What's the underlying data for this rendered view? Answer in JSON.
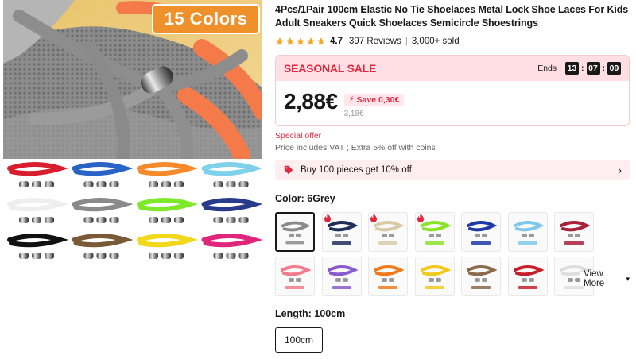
{
  "hero": {
    "badge_text": "15 Colors",
    "lace_colors": [
      "#d81e2c",
      "#2a63c6",
      "#f58a2a",
      "#7fd0ea",
      "#f5f5f5",
      "#8a8a8a",
      "#7ee82a",
      "#283a8a",
      "#111111",
      "#7a5a36",
      "#f2d81a",
      "#e0267a"
    ]
  },
  "product": {
    "title": "4Pcs/1Pair 100cm Elastic No Tie Shoelaces Metal Lock Shoe Laces For Kids Adult Sneakers Quick Shoelaces Semicircle Shoestrings",
    "rating": "4.7",
    "reviews": "397 Reviews",
    "separator": "|",
    "sold": "3,000+ sold"
  },
  "sale": {
    "label": "SEASONAL SALE",
    "ends_label": "Ends :",
    "hours": "13",
    "minutes": "07",
    "seconds": "09",
    "price": "2,88€",
    "save_text": "Save 0,30€",
    "old_price": "3,18€"
  },
  "special_offer": "Special offer",
  "vat_note": "Price includes VAT ; Extra 5% off with coins",
  "bulk": {
    "text": "Buy 100 pieces get 10% off"
  },
  "color": {
    "label": "Color: 6Grey",
    "swatches": [
      {
        "color": "#8a8a8a",
        "selected": true,
        "hot": false
      },
      {
        "color": "#1f2f5a",
        "selected": false,
        "hot": true
      },
      {
        "color": "#d9c9a8",
        "selected": false,
        "hot": true
      },
      {
        "color": "#8be22a",
        "selected": false,
        "hot": true
      },
      {
        "color": "#1f3aa8",
        "selected": false,
        "hot": false
      },
      {
        "color": "#7fc8ea",
        "selected": false,
        "hot": false
      },
      {
        "color": "#a8203a",
        "selected": false,
        "hot": false
      },
      {
        "color": "#f27a8a",
        "selected": false,
        "hot": false
      },
      {
        "color": "#8a5ad0",
        "selected": false,
        "hot": false
      },
      {
        "color": "#f07a1a",
        "selected": false,
        "hot": false
      },
      {
        "color": "#f2c81a",
        "selected": false,
        "hot": false
      },
      {
        "color": "#8a6a4a",
        "selected": false,
        "hot": false
      },
      {
        "color": "#c81e2a",
        "selected": false,
        "hot": false
      },
      {
        "color": "#f2f2f2",
        "selected": false,
        "hot": false
      }
    ],
    "view_more": "View More"
  },
  "length": {
    "label": "Length: 100cm",
    "option": "100cm"
  },
  "colors": {
    "accent": "#e0283e",
    "sale_bg": "#ffdfe3",
    "star": "#f5a623"
  }
}
